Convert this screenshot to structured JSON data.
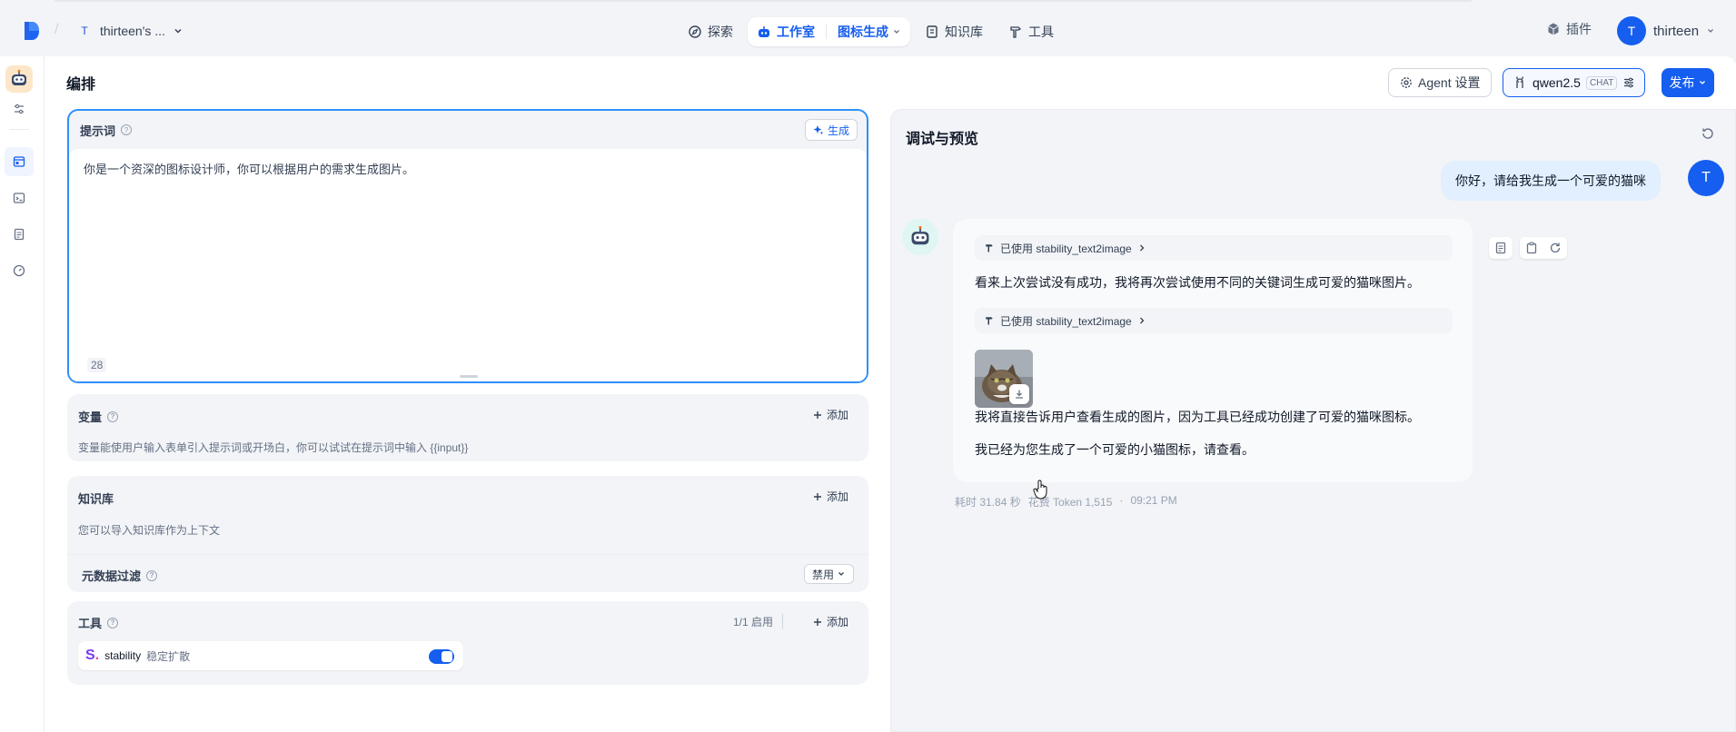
{
  "topbar": {
    "workspace_initial": "T",
    "workspace_name": "thirteen's ...",
    "nav": {
      "explore": "探索",
      "studio": "工作室",
      "app_name": "图标生成",
      "datasets": "知识库",
      "tools": "工具"
    },
    "plugins": "插件",
    "account_initial": "T",
    "account_name": "thirteen"
  },
  "header": {
    "title": "编排",
    "agent_settings": "Agent 设置",
    "model_name": "qwen2.5",
    "model_tag": "CHAT",
    "publish": "发布"
  },
  "prompt": {
    "title": "提示词",
    "generate": "生成",
    "text": "你是一个资深的图标设计师，你可以根据用户的需求生成图片。",
    "char_count": "28"
  },
  "variables": {
    "title": "变量",
    "add": "添加",
    "desc": "变量能使用户输入表单引入提示词或开场白，你可以试试在提示词中输入 {{input}}"
  },
  "knowledge": {
    "title": "知识库",
    "add": "添加",
    "desc": "您可以导入知识库作为上下文",
    "metadata_filter": "元数据过滤",
    "metadata_value": "禁用"
  },
  "tools": {
    "title": "工具",
    "enabled_count": "1/1 启用",
    "add": "添加",
    "items": [
      {
        "name": "stability",
        "desc": "稳定扩散",
        "enabled": true
      }
    ]
  },
  "debug": {
    "title": "调试与预览",
    "user_initial": "T",
    "user_message": "你好，请给我生成一个可爱的猫咪",
    "tool_used_1": "已使用 stability_text2image",
    "bot_text_1": "看来上次尝试没有成功，我将再次尝试使用不同的关键词生成可爱的猫咪图片。",
    "tool_used_2": "已使用 stability_text2image",
    "bot_text_2": "我将直接告诉用户查看生成的图片，因为工具已经成功创建了可爱的猫咪图标。",
    "bot_text_3": "我已经为您生成了一个可爱的小猫图标，请查看。",
    "elapsed": "耗时 31.84 秒",
    "tokens": "花费 Token 1,515",
    "dot": "·",
    "time": "09:21 PM"
  },
  "colors": {
    "accent": "#155eef",
    "focus_border": "#2e90fa",
    "user_bubble": "#e1effe",
    "panel_bg": "#f2f4f7"
  }
}
